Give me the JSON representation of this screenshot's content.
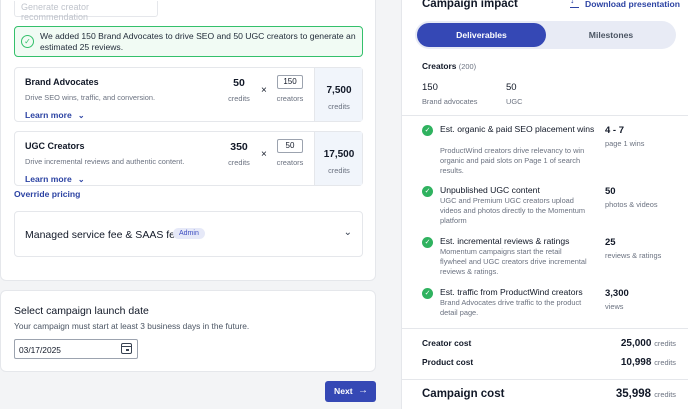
{
  "left": {
    "generate_button": "Generate creator recommendation",
    "success_message": "We added 150 Brand Advocates to drive SEO and 50 UGC creators to generate an estimated 25 reviews.",
    "items": [
      {
        "title": "Brand Advocates",
        "desc": "Drive SEO wins, traffic, and conversion.",
        "learn_more": "Learn more",
        "credits": "50",
        "credits_label": "credits",
        "times": "×",
        "qty": "150",
        "qty_label": "creators",
        "total": "7,500",
        "total_label": "credits"
      },
      {
        "title": "UGC Creators",
        "desc": "Drive incremental reviews and authentic content.",
        "learn_more": "Learn more",
        "credits": "350",
        "credits_label": "credits",
        "times": "×",
        "qty": "50",
        "qty_label": "creators",
        "total": "17,500",
        "total_label": "credits"
      }
    ],
    "override_pricing": "Override pricing",
    "managed": {
      "title": "Managed service fee & SAAS fee",
      "badge": "Admin"
    },
    "launch": {
      "title": "Select campaign launch date",
      "subtitle": "Your campaign must start at least 3 business days in the future.",
      "date": "03/17/2025"
    },
    "next_button": "Next"
  },
  "right": {
    "title": "Campaign impact",
    "download": "Download presentation",
    "tabs": [
      "Deliverables",
      "Milestones"
    ],
    "creators_label": "Creators",
    "creators_count": "(200)",
    "creator_stats": [
      {
        "value": "150",
        "label": "Brand advocates"
      },
      {
        "value": "50",
        "label": "UGC"
      }
    ],
    "deliverables": [
      {
        "title": "Est. organic & paid SEO placement wins",
        "desc": "ProductWind creators drive relevancy to win organic and paid slots on Page 1 of search results.",
        "value": "4 - 7",
        "unit": "page 1 wins"
      },
      {
        "title": "Unpublished UGC content",
        "desc": "UGC and Premium UGC creators upload videos and photos directly to the Momentum platform",
        "value": "50",
        "unit": "photos & videos"
      },
      {
        "title": "Est. incremental reviews & ratings",
        "desc": "Momentum campaigns start the retail flywheel and UGC creators drive incremental reviews & ratings.",
        "value": "25",
        "unit": "reviews & ratings"
      },
      {
        "title": "Est. traffic from ProductWind creators",
        "desc": "Brand Advocates drive traffic to the product detail page.",
        "value": "3,300",
        "unit": "views"
      }
    ],
    "costs": [
      {
        "label": "Creator cost",
        "value": "25,000",
        "unit": "credits"
      },
      {
        "label": "Product cost",
        "value": "10,998",
        "unit": "credits"
      }
    ],
    "total": {
      "label": "Campaign cost",
      "value": "35,998",
      "unit": "credits"
    }
  },
  "colors": {
    "accent": "#3548b5",
    "link": "#2c43a3",
    "success": "#2fb25f"
  }
}
